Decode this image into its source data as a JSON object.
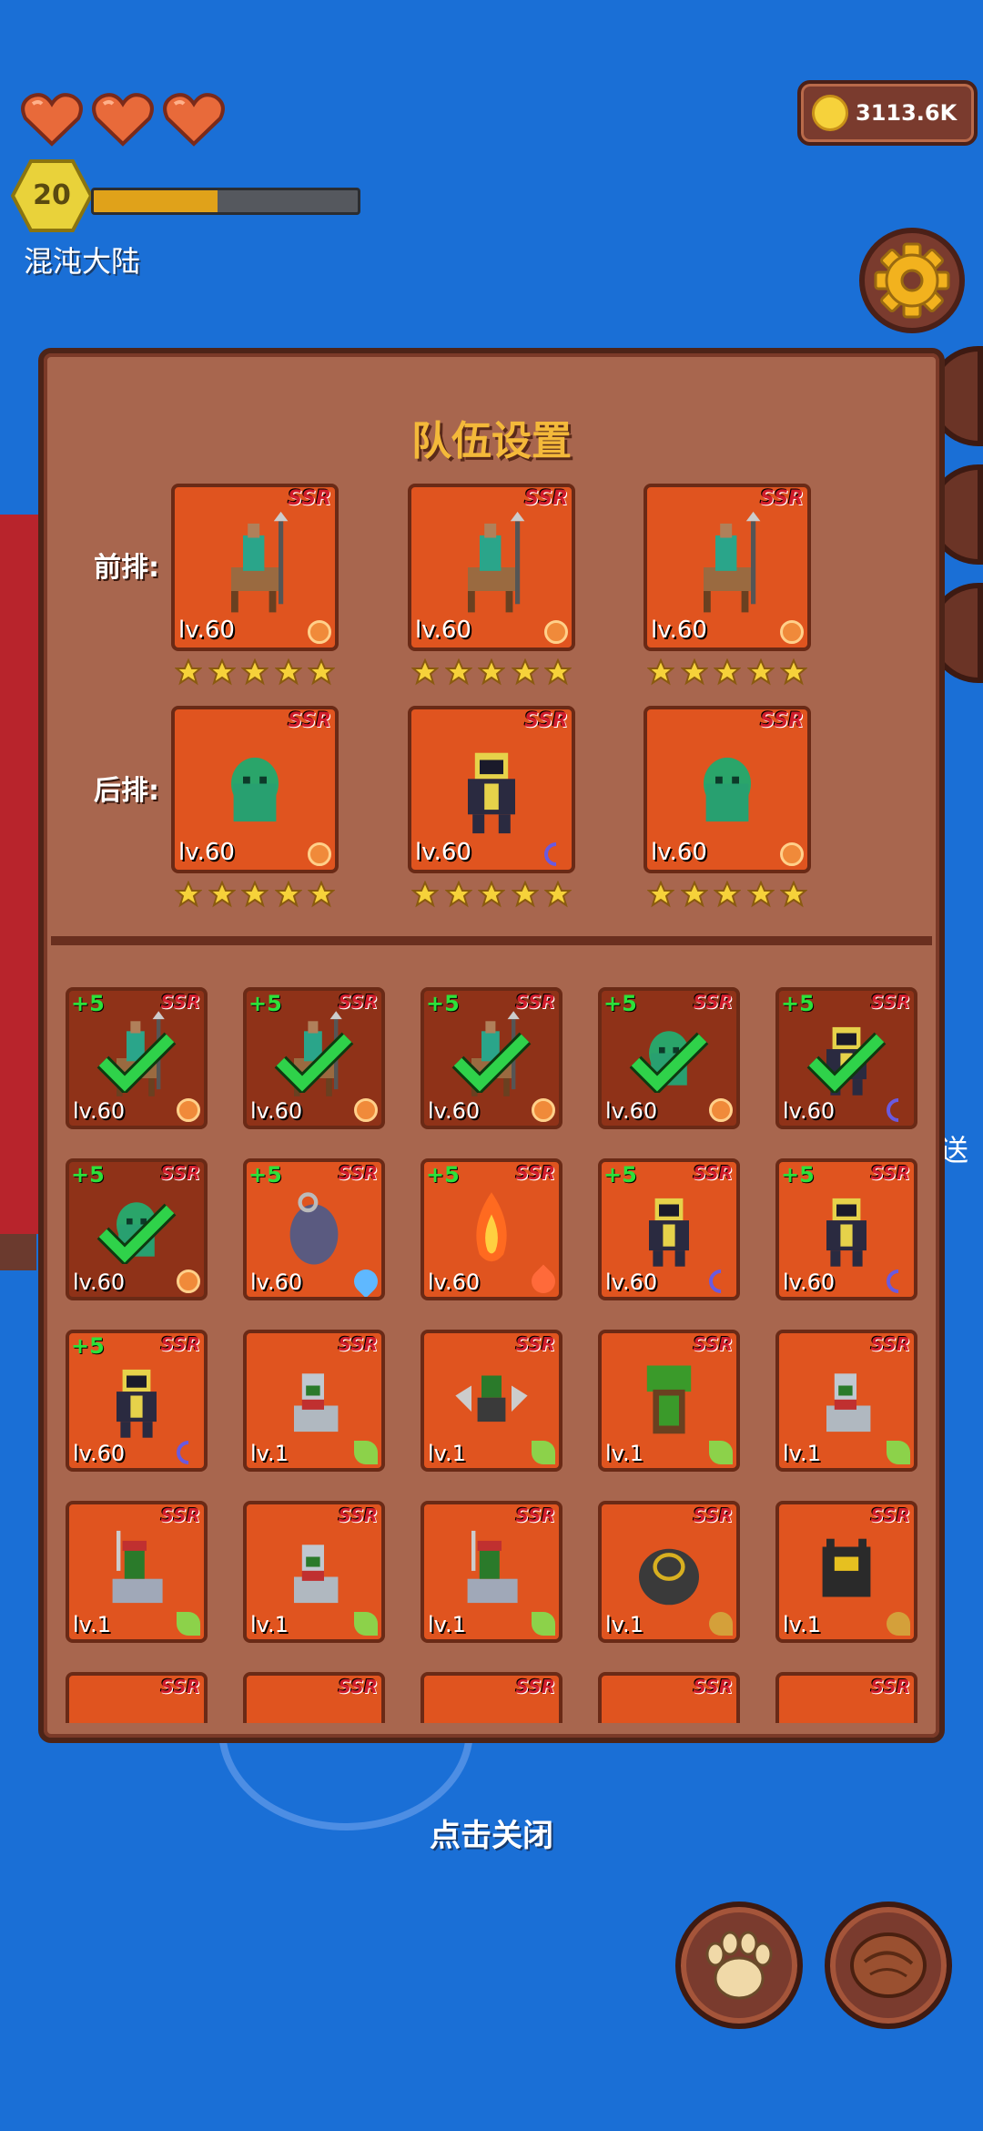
{
  "hud": {
    "hearts": 3,
    "level": "20",
    "xp_progress": 0.47,
    "region": "混沌大陆",
    "coins": "3113.6K",
    "edge_text": "送"
  },
  "dialog": {
    "title": "队伍设置",
    "front_label": "前排:",
    "back_label": "后排:",
    "front_row": [
      {
        "level": "lv.60",
        "rarity": "SSR",
        "stars": 5,
        "element": "sun",
        "sprite": "centaur"
      },
      {
        "level": "lv.60",
        "rarity": "SSR",
        "stars": 5,
        "element": "sun",
        "sprite": "centaur"
      },
      {
        "level": "lv.60",
        "rarity": "SSR",
        "stars": 5,
        "element": "sun",
        "sprite": "centaur"
      }
    ],
    "back_row": [
      {
        "level": "lv.60",
        "rarity": "SSR",
        "stars": 5,
        "element": "sun",
        "sprite": "slime-ghost"
      },
      {
        "level": "lv.60",
        "rarity": "SSR",
        "stars": 5,
        "element": "moon",
        "sprite": "dark-knight"
      },
      {
        "level": "lv.60",
        "rarity": "SSR",
        "stars": 5,
        "element": "sun",
        "sprite": "slime-ghost"
      }
    ],
    "pool": [
      {
        "plus": "+5",
        "level": "lv.60",
        "rarity": "SSR",
        "element": "sun",
        "sprite": "centaur",
        "in_team": true
      },
      {
        "plus": "+5",
        "level": "lv.60",
        "rarity": "SSR",
        "element": "sun",
        "sprite": "centaur",
        "in_team": true
      },
      {
        "plus": "+5",
        "level": "lv.60",
        "rarity": "SSR",
        "element": "sun",
        "sprite": "centaur",
        "in_team": true
      },
      {
        "plus": "+5",
        "level": "lv.60",
        "rarity": "SSR",
        "element": "sun",
        "sprite": "slime-ghost",
        "in_team": true
      },
      {
        "plus": "+5",
        "level": "lv.60",
        "rarity": "SSR",
        "element": "moon",
        "sprite": "dark-knight",
        "in_team": true
      },
      {
        "plus": "+5",
        "level": "lv.60",
        "rarity": "SSR",
        "element": "sun",
        "sprite": "slime-ghost",
        "in_team": true
      },
      {
        "plus": "+5",
        "level": "lv.60",
        "rarity": "SSR",
        "element": "water",
        "sprite": "hooded-mage",
        "in_team": false
      },
      {
        "plus": "+5",
        "level": "lv.60",
        "rarity": "SSR",
        "element": "fire",
        "sprite": "fire-spirit",
        "in_team": false
      },
      {
        "plus": "+5",
        "level": "lv.60",
        "rarity": "SSR",
        "element": "moon",
        "sprite": "dark-knight",
        "in_team": false
      },
      {
        "plus": "+5",
        "level": "lv.60",
        "rarity": "SSR",
        "element": "moon",
        "sprite": "dark-knight",
        "in_team": false
      },
      {
        "plus": "+5",
        "level": "lv.60",
        "rarity": "SSR",
        "element": "moon",
        "sprite": "dark-knight",
        "in_team": false
      },
      {
        "plus": "",
        "level": "lv.1",
        "rarity": "SSR",
        "element": "leaf",
        "sprite": "wolf-orc",
        "in_team": false
      },
      {
        "plus": "",
        "level": "lv.1",
        "rarity": "SSR",
        "element": "leaf",
        "sprite": "axe-orc",
        "in_team": false
      },
      {
        "plus": "",
        "level": "lv.1",
        "rarity": "SSR",
        "element": "leaf",
        "sprite": "treant",
        "in_team": false
      },
      {
        "plus": "",
        "level": "lv.1",
        "rarity": "SSR",
        "element": "leaf",
        "sprite": "wolf-orc",
        "in_team": false
      },
      {
        "plus": "",
        "level": "lv.1",
        "rarity": "SSR",
        "element": "leaf",
        "sprite": "wolf-rider",
        "in_team": false
      },
      {
        "plus": "",
        "level": "lv.1",
        "rarity": "SSR",
        "element": "leaf",
        "sprite": "wolf-orc",
        "in_team": false
      },
      {
        "plus": "",
        "level": "lv.1",
        "rarity": "SSR",
        "element": "leaf",
        "sprite": "wolf-rider",
        "in_team": false
      },
      {
        "plus": "",
        "level": "lv.1",
        "rarity": "SSR",
        "element": "earth",
        "sprite": "stone-golem",
        "in_team": false
      },
      {
        "plus": "",
        "level": "lv.1",
        "rarity": "SSR",
        "element": "earth",
        "sprite": "black-golem",
        "in_team": false
      },
      {
        "plus": "",
        "level": "",
        "rarity": "SSR",
        "element": "",
        "sprite": "",
        "in_team": false
      },
      {
        "plus": "",
        "level": "",
        "rarity": "SSR",
        "element": "",
        "sprite": "",
        "in_team": false
      },
      {
        "plus": "",
        "level": "",
        "rarity": "SSR",
        "element": "",
        "sprite": "",
        "in_team": false
      },
      {
        "plus": "",
        "level": "",
        "rarity": "SSR",
        "element": "",
        "sprite": "",
        "in_team": false
      },
      {
        "plus": "",
        "level": "",
        "rarity": "SSR",
        "element": "",
        "sprite": "",
        "in_team": false
      }
    ]
  },
  "close_hint": "点击关闭",
  "colors": {
    "background": "#1a6fd6",
    "panel": "#a8664e",
    "card": "#e0541f",
    "card_in_team": "#8f3218",
    "title": "#f4b93a",
    "check": "#2fd24a"
  }
}
